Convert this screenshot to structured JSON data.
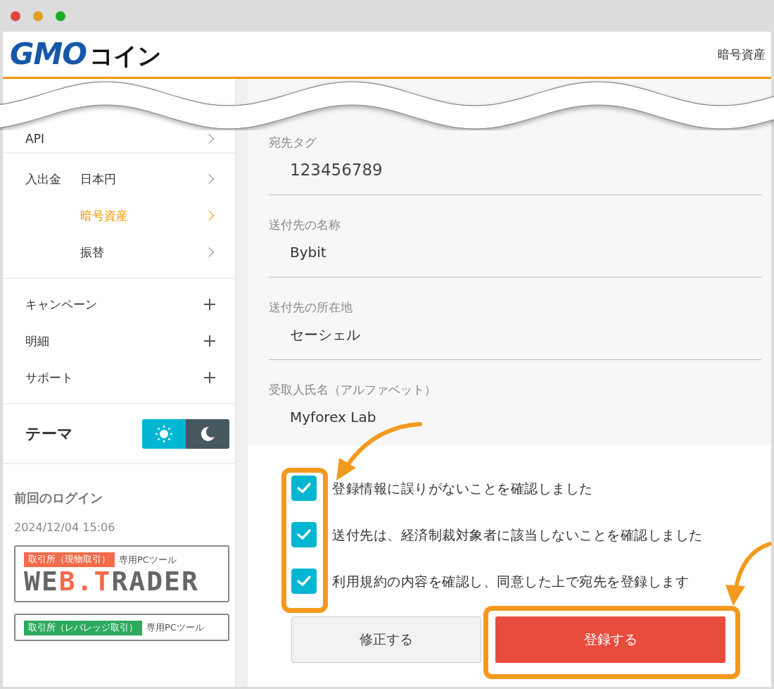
{
  "header": {
    "logo_primary": "GMO",
    "logo_secondary": "コイン",
    "nav_text": "暗号資産"
  },
  "sidebar": {
    "sections": [
      {
        "items": [
          {
            "label": "API",
            "kind": "link",
            "selected": false
          }
        ]
      },
      {
        "group_label": "入出金",
        "items": [
          {
            "label": "日本円",
            "kind": "link",
            "selected": false
          },
          {
            "label": "暗号資産",
            "kind": "link",
            "selected": true
          },
          {
            "label": "振替",
            "kind": "link",
            "selected": false
          }
        ]
      },
      {
        "items": [
          {
            "label": "キャンペーン",
            "kind": "expand",
            "selected": false
          },
          {
            "label": "明細",
            "kind": "expand",
            "selected": false
          },
          {
            "label": "サポート",
            "kind": "expand",
            "selected": false
          }
        ]
      }
    ],
    "theme": {
      "label": "テーマ",
      "options": [
        {
          "kind": "light",
          "selected": true
        },
        {
          "kind": "dark",
          "selected": false
        }
      ]
    },
    "last_login": {
      "label": "前回のログイン",
      "value": "2024/12/04 15:06"
    },
    "banners": [
      {
        "tag": "取引所（現物取引）",
        "color": "#f26b4a",
        "suffix": "専用PCツール",
        "title_parts": [
          {
            "text": "WE",
            "accent": false
          },
          {
            "text": "B.T",
            "accent": true
          },
          {
            "text": "RADER",
            "accent": false
          }
        ]
      },
      {
        "tag": "取引所（レバレッジ取引）",
        "color": "#2eaa5f",
        "suffix": "専用PCツール"
      }
    ]
  },
  "main": {
    "fields": [
      {
        "label": "宛先タグ",
        "value": "123456789"
      },
      {
        "label": "送付先の名称",
        "value": "Bybit"
      },
      {
        "label": "送付先の所在地",
        "value": "セーシェル"
      },
      {
        "label": "受取人氏名（アルファベット）",
        "value": "Myforex Lab"
      }
    ],
    "checkboxes": [
      {
        "label": "登録情報に誤りがないことを確認しました",
        "checked": true
      },
      {
        "label": "送付先は、経済制裁対象者に該当しないことを確認しました",
        "checked": true
      },
      {
        "label": "利用規約の内容を確認し、同意した上で宛先を登録します",
        "checked": true
      }
    ],
    "buttons": [
      {
        "label": "修正する",
        "kind": "secondary"
      },
      {
        "label": "登録する",
        "kind": "primary"
      }
    ]
  }
}
